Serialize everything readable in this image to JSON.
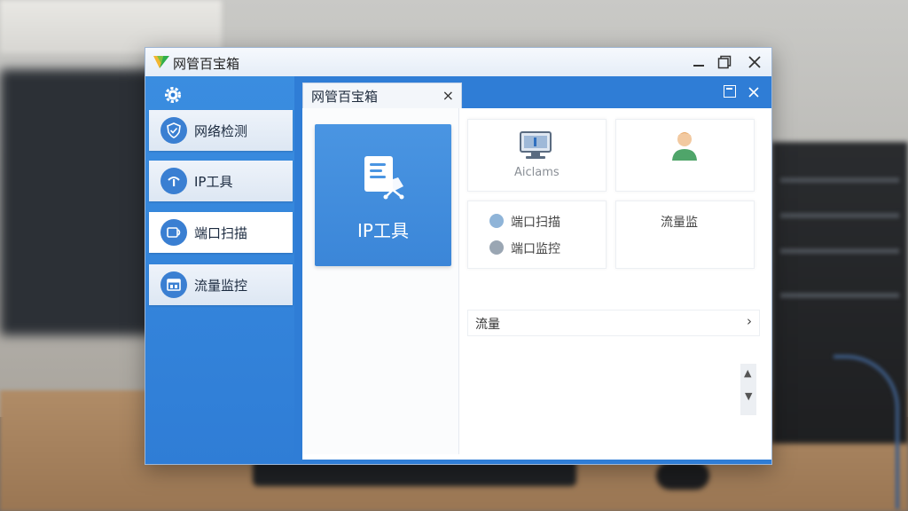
{
  "window": {
    "title": "网管百宝箱",
    "controls": [
      "minimize",
      "maximize",
      "close"
    ]
  },
  "sidebar": {
    "settings_icon": "gear-icon",
    "items": [
      {
        "label": "网络检测",
        "icon": "shield-check-icon",
        "active": false
      },
      {
        "label": "IP工具",
        "icon": "ip-icon",
        "active": false
      },
      {
        "label": "端口扫描",
        "icon": "port-scan-icon",
        "active": true
      },
      {
        "label": "流量监控",
        "icon": "traffic-monitor-icon",
        "active": false
      }
    ]
  },
  "tab": {
    "label": "网管百宝箱",
    "close": "×"
  },
  "main": {
    "ip_card": {
      "label": "IP工具",
      "icon": "document-network-icon"
    },
    "tiles": {
      "monitor_tile_label": "Aiclams",
      "port_scan_label": "端口扫描",
      "port_monitor_label": "端口监控",
      "traffic_label": "流量监"
    },
    "flow_row": {
      "label": "流量",
      "arrow": "›"
    },
    "scrollbar": {
      "up": "▲",
      "down": "▼"
    }
  },
  "colors": {
    "sidebar_blue": "#2f7dd6",
    "card_blue": "#3b86d8",
    "icon_blue": "#3a7fd2"
  }
}
